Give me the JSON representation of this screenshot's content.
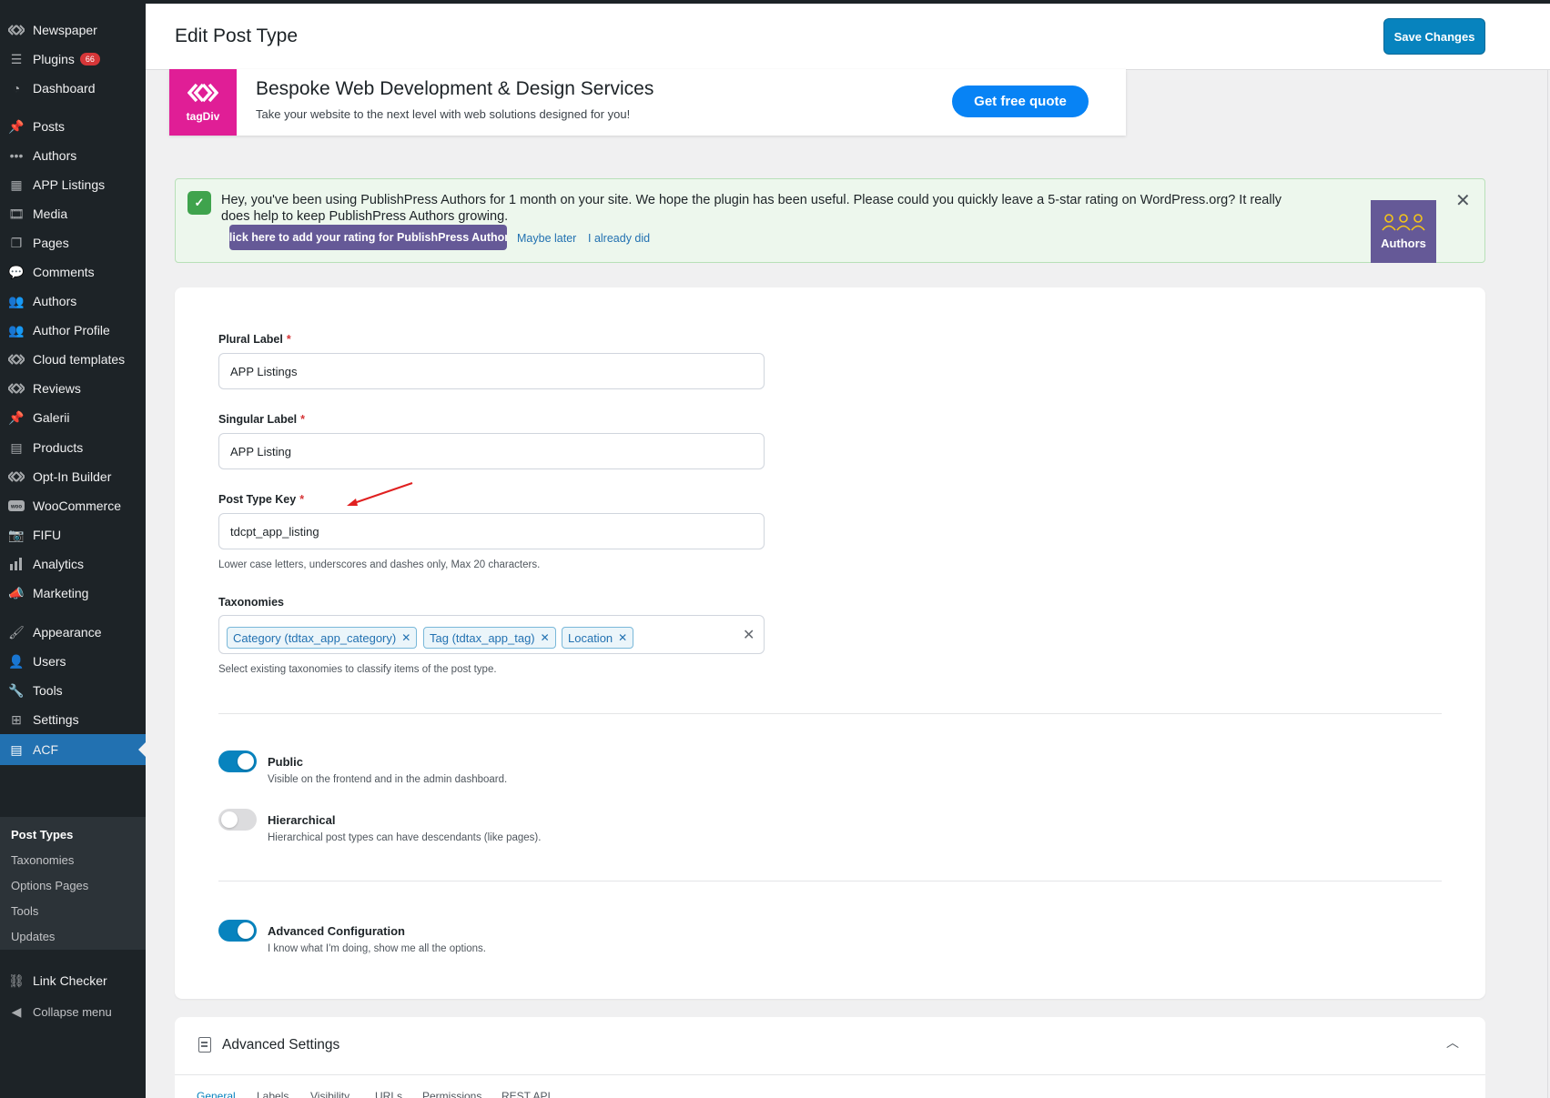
{
  "header": {
    "title": "Edit Post Type",
    "save_label": "Save Changes"
  },
  "sidebar": {
    "items": [
      {
        "label": "Newspaper",
        "icon": "tagdiv-icon"
      },
      {
        "label": "Plugins",
        "icon": "plugins-icon",
        "badge": "66"
      },
      {
        "label": "Dashboard",
        "icon": "dashboard-icon"
      },
      {
        "label": "Posts",
        "icon": "pin-icon"
      },
      {
        "label": "Authors",
        "icon": "dots-icon"
      },
      {
        "label": "APP Listings",
        "icon": "table-icon"
      },
      {
        "label": "Media",
        "icon": "media-icon"
      },
      {
        "label": "Pages",
        "icon": "pages-icon"
      },
      {
        "label": "Comments",
        "icon": "comments-icon"
      },
      {
        "label": "Authors",
        "icon": "users-group-icon"
      },
      {
        "label": "Author Profile",
        "icon": "users-group-icon"
      },
      {
        "label": "Cloud templates",
        "icon": "tagdiv-icon"
      },
      {
        "label": "Reviews",
        "icon": "tagdiv-icon"
      },
      {
        "label": "Galerii",
        "icon": "pin-icon"
      },
      {
        "label": "Products",
        "icon": "products-icon"
      },
      {
        "label": "Opt-In Builder",
        "icon": "tagdiv-icon"
      },
      {
        "label": "WooCommerce",
        "icon": "woo-icon"
      },
      {
        "label": "FIFU",
        "icon": "camera-icon"
      },
      {
        "label": "Analytics",
        "icon": "bar-chart-icon"
      },
      {
        "label": "Marketing",
        "icon": "megaphone-icon"
      },
      {
        "label": "Appearance",
        "icon": "brush-icon"
      },
      {
        "label": "Users",
        "icon": "user-icon"
      },
      {
        "label": "Tools",
        "icon": "wrench-icon"
      },
      {
        "label": "Settings",
        "icon": "sliders-icon"
      },
      {
        "label": "ACF",
        "icon": "acf-icon"
      }
    ],
    "submenu": [
      "Post Types",
      "Taxonomies",
      "Options Pages",
      "Tools",
      "Updates"
    ],
    "link_checker": "Link Checker",
    "collapse": "Collapse menu"
  },
  "banner": {
    "brand": "tagDiv",
    "title": "Bespoke Web Development & Design Services",
    "subtitle": "Take your website to the next level with web solutions designed for you!",
    "button": "Get free quote"
  },
  "notice": {
    "text": "Hey, you've been using PublishPress Authors for 1 month on your site. We hope the plugin has been useful. Please could you quickly leave a 5-star rating on WordPress.org? It really does help to keep PublishPress Authors growing.",
    "rate_button": "Click here to add your rating for PublishPress Authors",
    "maybe_later": "Maybe later",
    "already_did": "I already did",
    "logo_label": "Authors"
  },
  "form": {
    "plural_label": "Plural Label",
    "plural_value": "APP Listings",
    "singular_label": "Singular Label",
    "singular_value": "APP Listing",
    "key_label": "Post Type Key",
    "key_value": "tdcpt_app_listing",
    "key_help": "Lower case letters, underscores and dashes only, Max 20 characters.",
    "required_mark": "*",
    "taxonomies_label": "Taxonomies",
    "taxonomies": [
      "Category (tdtax_app_category)",
      "Tag (tdtax_app_tag)",
      "Location"
    ],
    "taxonomies_help": "Select existing taxonomies to classify items of the post type."
  },
  "toggles": {
    "public": {
      "title": "Public",
      "desc": "Visible on the frontend and in the admin dashboard.",
      "on": true
    },
    "hierarchical": {
      "title": "Hierarchical",
      "desc": "Hierarchical post types can have descendants (like pages).",
      "on": false
    },
    "advanced": {
      "title": "Advanced Configuration",
      "desc": "I know what I'm doing, show me all the options.",
      "on": true
    }
  },
  "advanced_settings": {
    "title": "Advanced Settings",
    "tabs": [
      "General",
      "Labels",
      "Visibility",
      "URLs",
      "Permissions",
      "REST API"
    ]
  },
  "colors": {
    "accent": "#0783be",
    "sidebar_bg": "#1d2327",
    "active_menu": "#2271b1",
    "notice_bg": "#edf7ed",
    "authors_purple": "#655997",
    "tagdiv_pink": "#e01e96"
  }
}
